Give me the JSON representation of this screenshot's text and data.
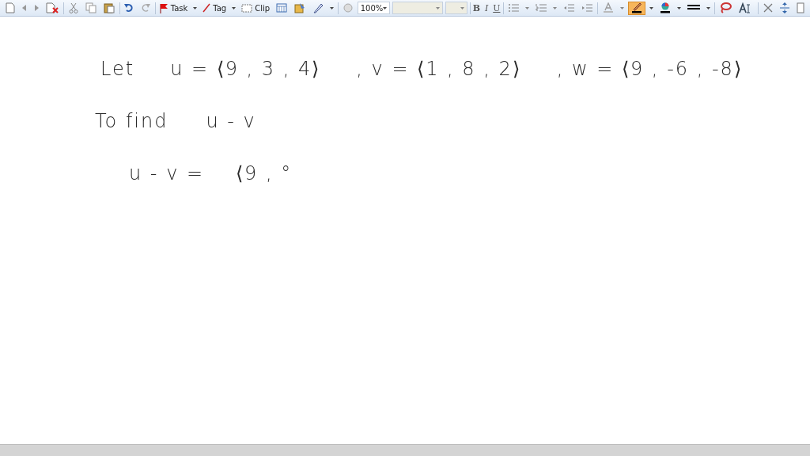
{
  "toolbar": {
    "task_label": "Task",
    "tag_label": "Tag",
    "clip_label": "Clip",
    "zoom_value": "100%",
    "bold_label": "B",
    "italic_label": "I",
    "underline_label": "U",
    "pen_color": {
      "selected": true
    }
  },
  "page": {
    "lines": [
      {
        "parts": [
          "Let",
          "u = ⟨9 , 3 , 4⟩",
          ", v = ⟨1 , 8 , 2⟩",
          ", w = ⟨9 , -6 , -8⟩"
        ]
      },
      {
        "parts": [
          "To find",
          "u - v"
        ]
      },
      {
        "parts": [
          "u - v =",
          "⟨9 , °"
        ]
      }
    ]
  }
}
